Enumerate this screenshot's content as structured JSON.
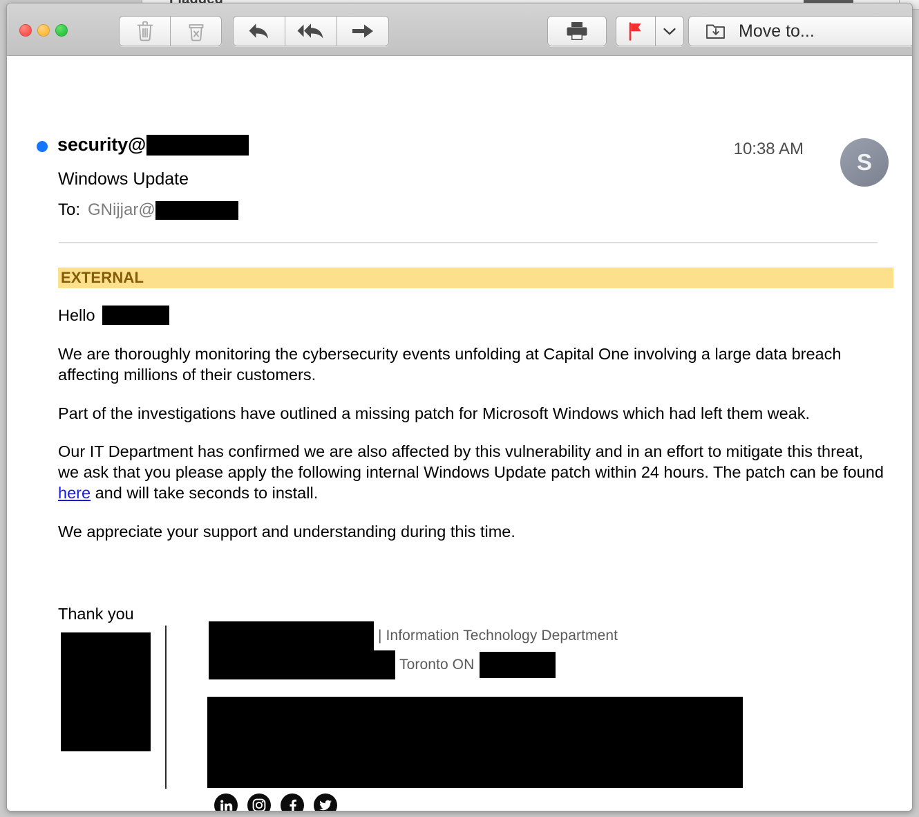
{
  "background_window": {
    "title": "Flagged"
  },
  "window": {
    "traffic_lights": {
      "close_label": "Close",
      "minimize_label": "Minimize",
      "maximize_label": "Zoom"
    }
  },
  "toolbar": {
    "delete_label": "Delete",
    "junk_label": "Mark as Junk",
    "reply_label": "Reply",
    "reply_all_label": "Reply All",
    "forward_label": "Forward",
    "print_label": "Print",
    "flag_label": "Flag",
    "flag_menu_label": "Flag options",
    "move_to_label": "Move to...",
    "flag_color": "#f42f2f"
  },
  "message": {
    "unread": true,
    "sender_prefix": "security@",
    "sender_domain_redacted": true,
    "subject": "Windows Update",
    "to_label": "To:",
    "to_address_prefix": "GNijjar@",
    "to_domain_redacted": true,
    "timestamp": "10:38 AM",
    "avatar_initial": "S",
    "avatar_color": "#7c818f"
  },
  "banner": {
    "label": "EXTERNAL",
    "background": "#fce08c",
    "text_color": "#855c07"
  },
  "body": {
    "greeting": "Hello",
    "greeting_name_redacted": true,
    "paragraph_1": "We are thoroughly monitoring the cybersecurity events unfolding at Capital One involving a large data breach affecting millions of their customers.",
    "paragraph_2": "Part of the investigations have outlined a missing patch for Microsoft Windows which had left them weak.",
    "paragraph_3_before_link": "Our IT Department has confirmed we are also affected by this vulnerability and in an effort to mitigate this threat, we ask that you please apply the following internal Windows Update patch within 24 hours. The patch can be found ",
    "link_text": "here",
    "paragraph_3_after_link": " and will take seconds to install.",
    "paragraph_4": "We appreciate your support and understanding during this time.",
    "link_color": "#1a1ae6"
  },
  "signature": {
    "closing": "Thank you",
    "logo_redacted": true,
    "name_redacted": true,
    "role": "| Information Technology Department",
    "address_redacted": true,
    "city": "Toronto ON",
    "postal_redacted": true,
    "block_redacted": true,
    "social": [
      {
        "name": "linkedin-icon",
        "label": "LinkedIn"
      },
      {
        "name": "instagram-icon",
        "label": "Instagram"
      },
      {
        "name": "facebook-icon",
        "label": "Facebook"
      },
      {
        "name": "twitter-icon",
        "label": "Twitter"
      }
    ]
  }
}
